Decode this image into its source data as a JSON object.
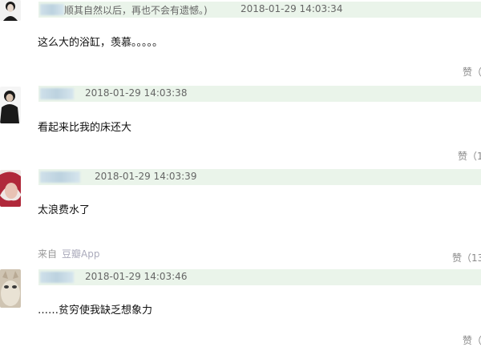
{
  "comments": [
    {
      "header_text": "顺其自然以后，再也不会有遗憾。)",
      "timestamp": "2018-01-29 14:03:34",
      "body": "这么大的浴缸，羡慕。。。。。",
      "like_label": "赞（",
      "avatar_colors": {
        "hair": "#1c1c1c",
        "skin": "#e8d8cc",
        "bg": "#f2f2f2"
      }
    },
    {
      "timestamp": "2018-01-29 14:03:38",
      "body": "看起来比我的床还大",
      "like_label": "赞（1",
      "avatar_colors": {
        "dark": "#1a1a1a",
        "skin": "#d9c3b0",
        "bg": "#f5f5f5"
      }
    },
    {
      "timestamp": "2018-01-29 14:03:39",
      "body": "太浪费水了",
      "like_label": "",
      "source_prefix": "来自",
      "source_app": "豆瓣App",
      "like_label_2": "赞（13",
      "avatar_colors": {
        "hair": "#b0283a",
        "skin": "#e8c2b4",
        "bg": "#efe7e4"
      }
    },
    {
      "timestamp": "2018-01-29 14:03:46",
      "body": "……贫穷使我缺乏想象力",
      "like_label": "赞（",
      "avatar_colors": {
        "fur": "#e9e2d4",
        "shade": "#b8a994",
        "bg": "#cfc4b2"
      }
    }
  ],
  "colors": {
    "header_bg": "#eaf4ea",
    "text": "#111111",
    "muted": "#666666",
    "like": "#888888"
  }
}
